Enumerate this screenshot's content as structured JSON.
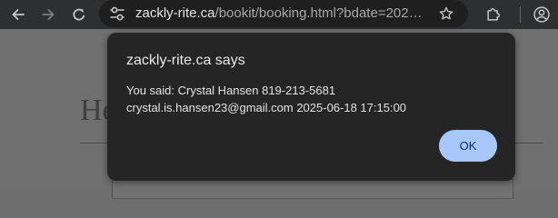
{
  "browser": {
    "url_host": "zackly-rite.ca",
    "url_path": "/bookit/booking.html?bdate=202…",
    "toolbar_icons": [
      "back-arrow-icon",
      "forward-arrow-icon",
      "reload-icon",
      "site-info-icon",
      "bookmark-star-icon",
      "extensions-puzzle-icon",
      "profile-avatar-icon"
    ]
  },
  "page": {
    "heading_visible": "He"
  },
  "dialog": {
    "title": "zackly-rite.ca says",
    "message_line1": "You said: Crystal Hansen 819-213-5681",
    "message_line2": "crystal.is.hansen23@gmail.com 2025-06-18 17:15:00",
    "ok_label": "OK"
  },
  "colors": {
    "toolbar_bg": "#2e2f31",
    "omnibox_bg": "#1f1f1f",
    "dialog_bg": "#252525",
    "ok_button_bg": "#a8c7fa",
    "ok_button_text": "#062e6f"
  }
}
